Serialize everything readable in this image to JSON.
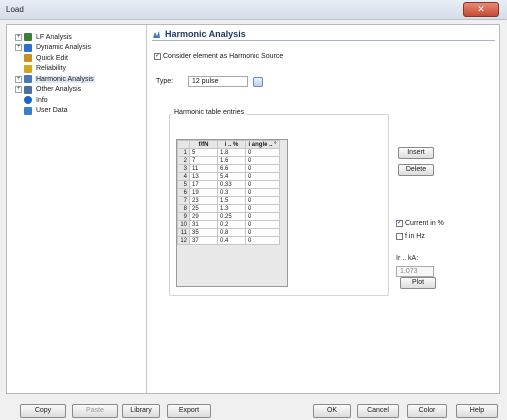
{
  "window": {
    "title": "Load",
    "close_glyph": "✕"
  },
  "tree": {
    "items": [
      {
        "label": "LF Analysis",
        "expander": "+",
        "icon": "lf-analysis-icon",
        "color": "#3c7f3c"
      },
      {
        "label": "Dynamic Analysis",
        "expander": "+",
        "icon": "dynamic-analysis-icon",
        "color": "#2f6fcc"
      },
      {
        "label": "Quick Edit",
        "expander": "",
        "icon": "quick-edit-icon",
        "color": "#c79220"
      },
      {
        "label": "Reliability",
        "expander": "",
        "icon": "reliability-icon",
        "color": "#d3a818"
      },
      {
        "label": "Harmonic Analysis",
        "expander": "+",
        "icon": "harmonic-analysis-icon",
        "color": "#4a78b8",
        "selected": true
      },
      {
        "label": "Other Analysis",
        "expander": "+",
        "icon": "other-analysis-icon",
        "color": "#4e6f9e"
      },
      {
        "label": "Info",
        "expander": "",
        "icon": "info-icon",
        "color": "#1d64c8"
      },
      {
        "label": "User Data",
        "expander": "",
        "icon": "user-data-icon",
        "color": "#3a7fd0"
      }
    ]
  },
  "page": {
    "title": "Harmonic Analysis",
    "consider_label": "Consider element as Harmonic Source",
    "consider_checked": "✓",
    "type_label": "Type:",
    "type_value": "12 pulse",
    "group_title": "Harmonic table entries",
    "columns": [
      "f/fN",
      "i .. %",
      "i angle .. °"
    ],
    "rows": [
      [
        "1",
        "5",
        "1.8",
        "0"
      ],
      [
        "2",
        "7",
        "1.6",
        "0"
      ],
      [
        "3",
        "11",
        "6.6",
        "0"
      ],
      [
        "4",
        "13",
        "5.4",
        "0"
      ],
      [
        "5",
        "17",
        "0.33",
        "0"
      ],
      [
        "6",
        "19",
        "0.3",
        "0"
      ],
      [
        "7",
        "23",
        "1.5",
        "0"
      ],
      [
        "8",
        "25",
        "1.3",
        "0"
      ],
      [
        "9",
        "29",
        "0.25",
        "0"
      ],
      [
        "10",
        "31",
        "0.2",
        "0"
      ],
      [
        "11",
        "35",
        "0.8",
        "0"
      ],
      [
        "12",
        "37",
        "0.4",
        "0"
      ]
    ],
    "insert_label": "Insert",
    "delete_label": "Delete",
    "current_label": "Current in %",
    "current_checked": "✓",
    "fhz_label": "f in Hz",
    "ir_label": "Ir .. kA:",
    "ir_value": "1.073",
    "plot_label": "Plot"
  },
  "footer": {
    "copy": "Copy",
    "paste": "Paste",
    "library": "Library",
    "export": "Export",
    "ok": "OK",
    "cancel": "Cancel",
    "color": "Color",
    "help": "Help"
  },
  "colors": {
    "accent": "#1e395b",
    "selection": "#dfe9f6"
  }
}
